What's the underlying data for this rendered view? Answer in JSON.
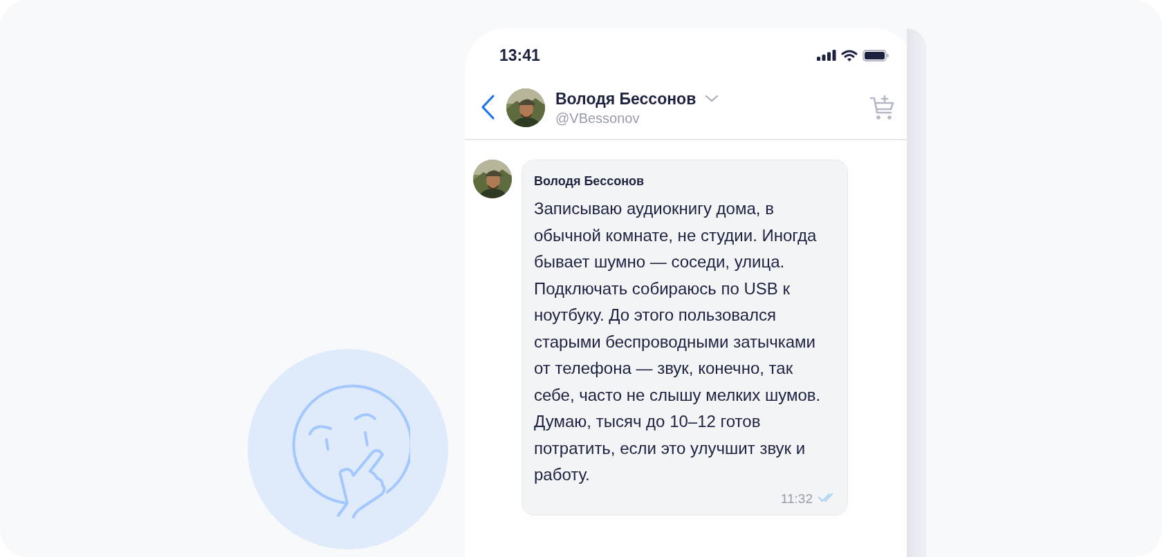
{
  "status_bar": {
    "time": "13:41"
  },
  "header": {
    "name": "Володя Бессонов",
    "handle": "@VBessonov"
  },
  "messages": [
    {
      "sender": "Володя Бессонов",
      "text": "Записываю аудиокнигу дома, в обычной комнате, не студии. Иногда бывает шумно — соседи, улица. Подключать собираюсь по USB к ноутбуку. До этого пользовался старыми беспроводными затычками от телефона — звук, конечно, так себе, часто не слышу мелких шумов. Думаю, тысяч до 10–12 готов потратить, если это улучшит звук и работу.",
      "time": "11:32",
      "read": true
    }
  ]
}
